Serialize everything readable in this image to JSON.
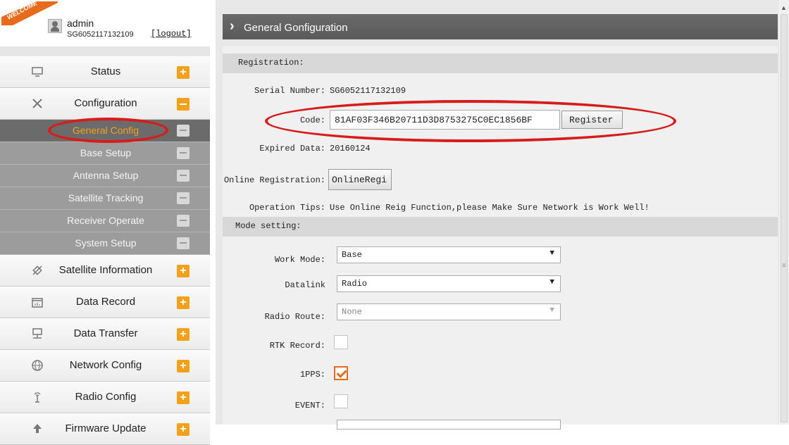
{
  "banner": {
    "text": "WELCOME",
    "color": "#e76b1b"
  },
  "user": {
    "name": "admin",
    "serial": "SG6052117132109",
    "logout_label": "[logout]",
    "avatar_icon": "user-icon"
  },
  "sidebar": {
    "items": [
      {
        "label": "Status",
        "icon": "monitor-icon",
        "toggle": "+"
      },
      {
        "label": "Configuration",
        "icon": "tools-icon",
        "toggle": "-"
      },
      {
        "label": "Satellite Information",
        "icon": "satellite-icon",
        "toggle": "+"
      },
      {
        "label": "Data Record",
        "icon": "calendar-icon",
        "toggle": "+"
      },
      {
        "label": "Data Transfer",
        "icon": "network-icon",
        "toggle": "+"
      },
      {
        "label": "Network Config",
        "icon": "globe-icon",
        "toggle": "+"
      },
      {
        "label": "Radio Config",
        "icon": "antenna-icon",
        "toggle": "+"
      },
      {
        "label": "Firmware Update",
        "icon": "upload-icon",
        "toggle": "+"
      }
    ],
    "sub_items": [
      {
        "label": "General Config",
        "active": true
      },
      {
        "label": "Base Setup"
      },
      {
        "label": "Antenna Setup"
      },
      {
        "label": "Satellite Tracking"
      },
      {
        "label": "Receiver Operate"
      },
      {
        "label": "System Setup"
      }
    ]
  },
  "main": {
    "title": "General Gonfiguration",
    "registration": {
      "header": "Registration:",
      "serial_label": "Serial Number:",
      "serial_value": "SG6052117132109",
      "code_label": "Code:",
      "code_value": "81AF03F346B20711D3D8753275C0EC1856BF",
      "register_button": "Register",
      "expired_label": "Expired Data:",
      "expired_value": "20160124",
      "online_label": "Online Registration:",
      "online_button": "OnlineRegi",
      "tips_label": "Operation Tips:",
      "tips_value": "Use Online Reig Function,please Make Sure Network is Work Well!"
    },
    "mode": {
      "header": "Mode setting:",
      "work_mode_label": "Work Mode:",
      "work_mode_value": "Base",
      "datalink_label": "Datalink",
      "datalink_value": "Radio",
      "radio_route_label": "Radio Route:",
      "radio_route_value": "None",
      "rtk_label": "RTK Record:",
      "rtk_checked": false,
      "pps_label": "1PPS:",
      "pps_checked": true,
      "event_label": "EVENT:",
      "event_checked": false
    }
  },
  "colors": {
    "accent": "#f2a11b",
    "highlight_ring": "#d81b1b",
    "checkbox_checked": "#e86a1d"
  }
}
